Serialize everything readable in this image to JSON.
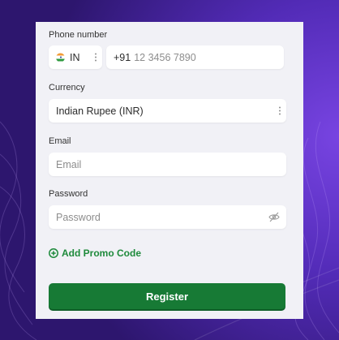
{
  "form": {
    "phone": {
      "label": "Phone number",
      "country_code": "IN",
      "dial_code": "+91",
      "placeholder": "12 3456 7890",
      "flag_icon": "india-flag-icon"
    },
    "currency": {
      "label": "Currency",
      "value": "Indian Rupee (INR)"
    },
    "email": {
      "label": "Email",
      "placeholder": "Email"
    },
    "password": {
      "label": "Password",
      "placeholder": "Password",
      "toggle_icon": "eye-off-icon"
    },
    "promo_label": "Add Promo Code",
    "register_label": "Register"
  },
  "colors": {
    "accent_green": "#177a35",
    "promo_green": "#1e8a3b",
    "card_bg": "#f1f1f6",
    "background_purple": "#3b1f94"
  }
}
